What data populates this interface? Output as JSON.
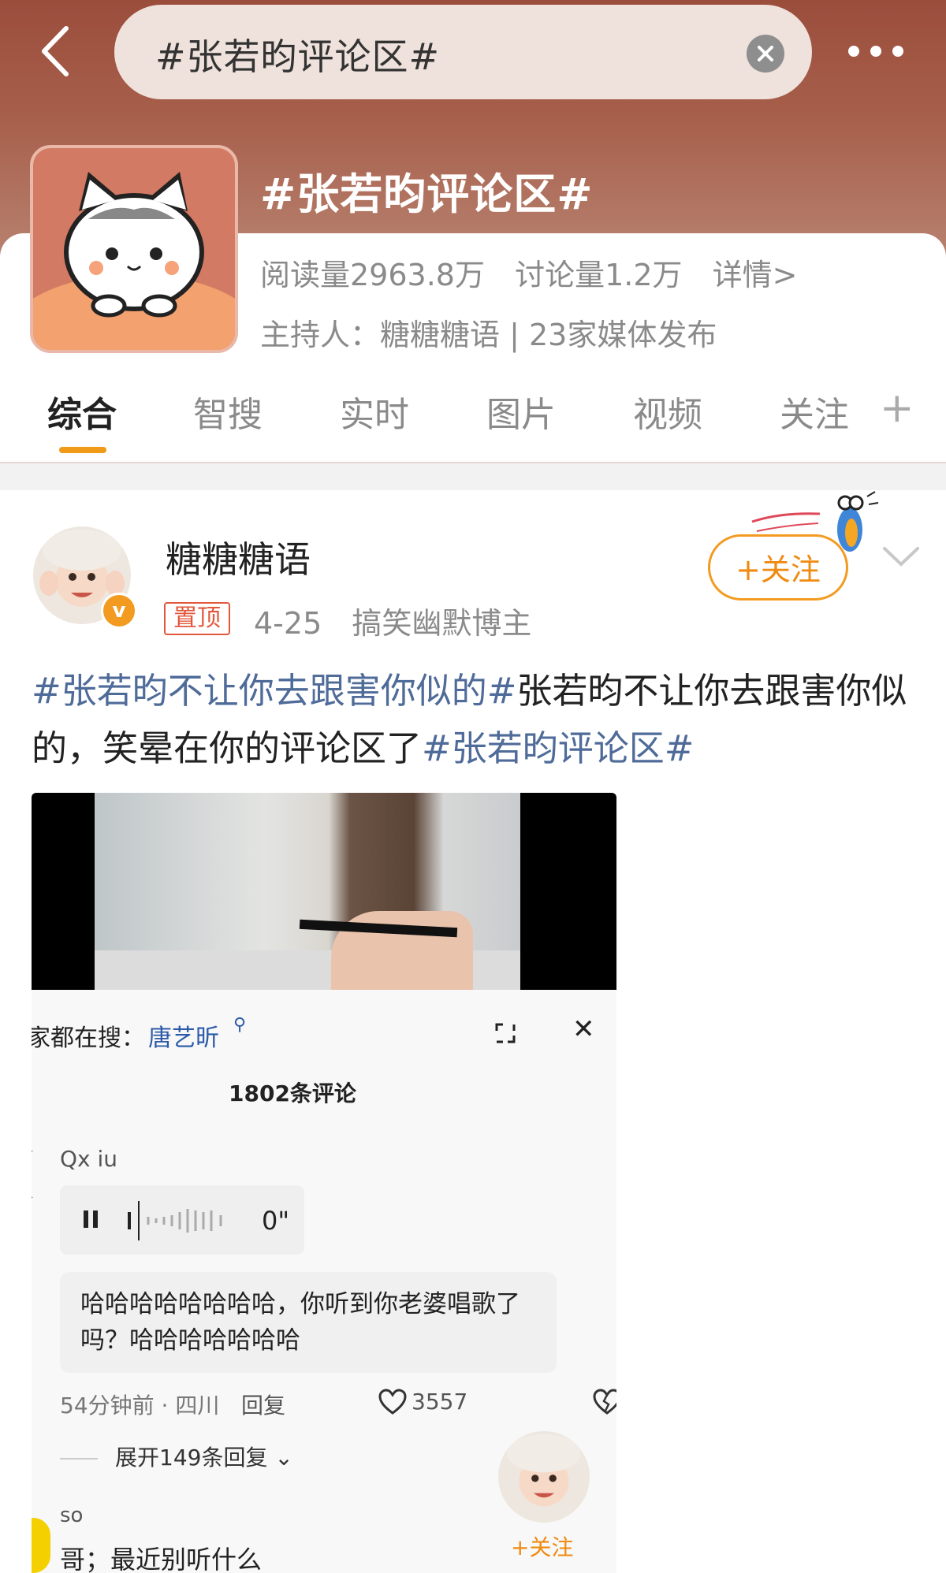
{
  "colors": {
    "accent": "#f39b21",
    "hashtag": "#4f6b99",
    "pin": "#e2573b",
    "header_bg": "#a7604c"
  },
  "header": {
    "search_text": "#张若昀评论区#",
    "icons": {
      "back": "chevron-left-icon",
      "clear": "clear-icon",
      "more": "more-dots-icon"
    }
  },
  "topic": {
    "title": "#张若昀评论区#",
    "reads": "阅读量2963.8万",
    "discussions": "讨论量1.2万",
    "details": "详情>",
    "host": "主持人：糖糖糖语 | 23家媒体发布"
  },
  "tabs": [
    {
      "label": "综合",
      "active": true
    },
    {
      "label": "智搜"
    },
    {
      "label": "实时"
    },
    {
      "label": "图片"
    },
    {
      "label": "视频"
    },
    {
      "label": "关注"
    }
  ],
  "tab_plus": "+",
  "post": {
    "author": "糖糖糖语",
    "verified_badge": "v",
    "pin_label": "置顶",
    "date": "4-25",
    "author_tag": "搞笑幽默博主",
    "follow_label": "+关注",
    "text": {
      "hashtag1": "#张若昀不让你去跟害你似的#",
      "body": "张若昀不让你去跟害你似的，笑晕在你的评论区了",
      "hashtag2": "#张若昀评论区#"
    }
  },
  "embedded": {
    "search_label": "家都在搜：",
    "search_term": "唐艺昕",
    "comment_count": "1802条评论",
    "comment1": {
      "user": "Qx iu",
      "voice_duration": "0\"",
      "text": "哈哈哈哈哈哈哈哈，你听到你老婆唱歌了吗？哈哈哈哈哈哈哈",
      "time_location": "54分钟前 · 四川",
      "reply": "回复",
      "likes": "3557"
    },
    "expand_replies": "展开149条回复",
    "comment2": {
      "user": "so",
      "text": "哥；最近别听什么"
    },
    "follow_label": "+关注"
  }
}
